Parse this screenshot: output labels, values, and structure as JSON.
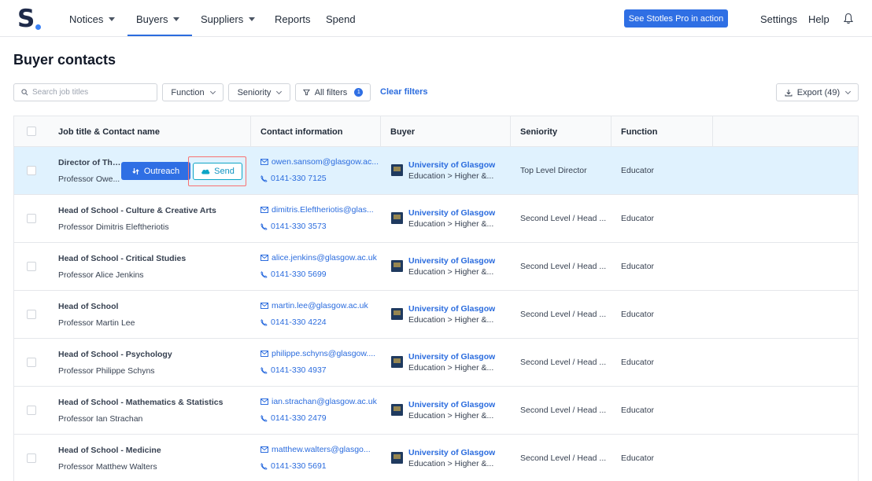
{
  "nav": {
    "logo": "S",
    "items": [
      {
        "label": "Notices",
        "dropdown": true
      },
      {
        "label": "Buyers",
        "dropdown": true
      },
      {
        "label": "Suppliers",
        "dropdown": true
      },
      {
        "label": "Reports",
        "dropdown": false
      },
      {
        "label": "Spend",
        "dropdown": false
      }
    ],
    "cta": "See Stotles Pro in action",
    "settings": "Settings",
    "help": "Help"
  },
  "page": {
    "title": "Buyer contacts"
  },
  "filters": {
    "search_placeholder": "Search job titles",
    "function": "Function",
    "seniority": "Seniority",
    "all_filters": "All filters",
    "filter_count": "1",
    "clear": "Clear filters",
    "export": "Export (49)"
  },
  "table": {
    "headers": [
      "Job title & Contact name",
      "Contact information",
      "Buyer",
      "Seniority",
      "Function"
    ],
    "actions": {
      "outreach": "Outreach",
      "send": "Send"
    },
    "rows": [
      {
        "job": "Director of The...",
        "name": "Professor Owe...",
        "email": "owen.sansom@glasgow.ac...",
        "phone": "0141-330 7125",
        "buyer": "University of Glasgow",
        "category": "Education > Higher &...",
        "seniority": "Top Level Director",
        "function": "Educator"
      },
      {
        "job": "Head of School - Culture & Creative Arts",
        "name": "Professor Dimitris Eleftheriotis",
        "email": "dimitris.Eleftheriotis@glas...",
        "phone": "0141-330 3573",
        "buyer": "University of Glasgow",
        "category": "Education > Higher &...",
        "seniority": "Second Level / Head ...",
        "function": "Educator"
      },
      {
        "job": "Head of School - Critical Studies",
        "name": "Professor Alice Jenkins",
        "email": "alice.jenkins@glasgow.ac.uk",
        "phone": "0141-330 5699",
        "buyer": "University of Glasgow",
        "category": "Education > Higher &...",
        "seniority": "Second Level / Head ...",
        "function": "Educator"
      },
      {
        "job": "Head of School",
        "name": "Professor Martin Lee",
        "email": "martin.lee@glasgow.ac.uk",
        "phone": "0141-330 4224",
        "buyer": "University of Glasgow",
        "category": "Education > Higher &...",
        "seniority": "Second Level / Head ...",
        "function": "Educator"
      },
      {
        "job": "Head of School - Psychology",
        "name": "Professor Philippe Schyns",
        "email": "philippe.schyns@glasgow....",
        "phone": "0141-330 4937",
        "buyer": "University of Glasgow",
        "category": "Education > Higher &...",
        "seniority": "Second Level / Head ...",
        "function": "Educator"
      },
      {
        "job": "Head of School - Mathematics & Statistics",
        "name": "Professor Ian Strachan",
        "email": "ian.strachan@glasgow.ac.uk",
        "phone": "0141-330 2479",
        "buyer": "University of Glasgow",
        "category": "Education > Higher &...",
        "seniority": "Second Level / Head ...",
        "function": "Educator"
      },
      {
        "job": "Head of School - Medicine",
        "name": "Professor Matthew Walters",
        "email": "matthew.walters@glasgo...",
        "phone": "0141-330 5691",
        "buyer": "University of Glasgow",
        "category": "Education > Higher &...",
        "seniority": "Second Level / Head ...",
        "function": "Educator"
      }
    ]
  }
}
